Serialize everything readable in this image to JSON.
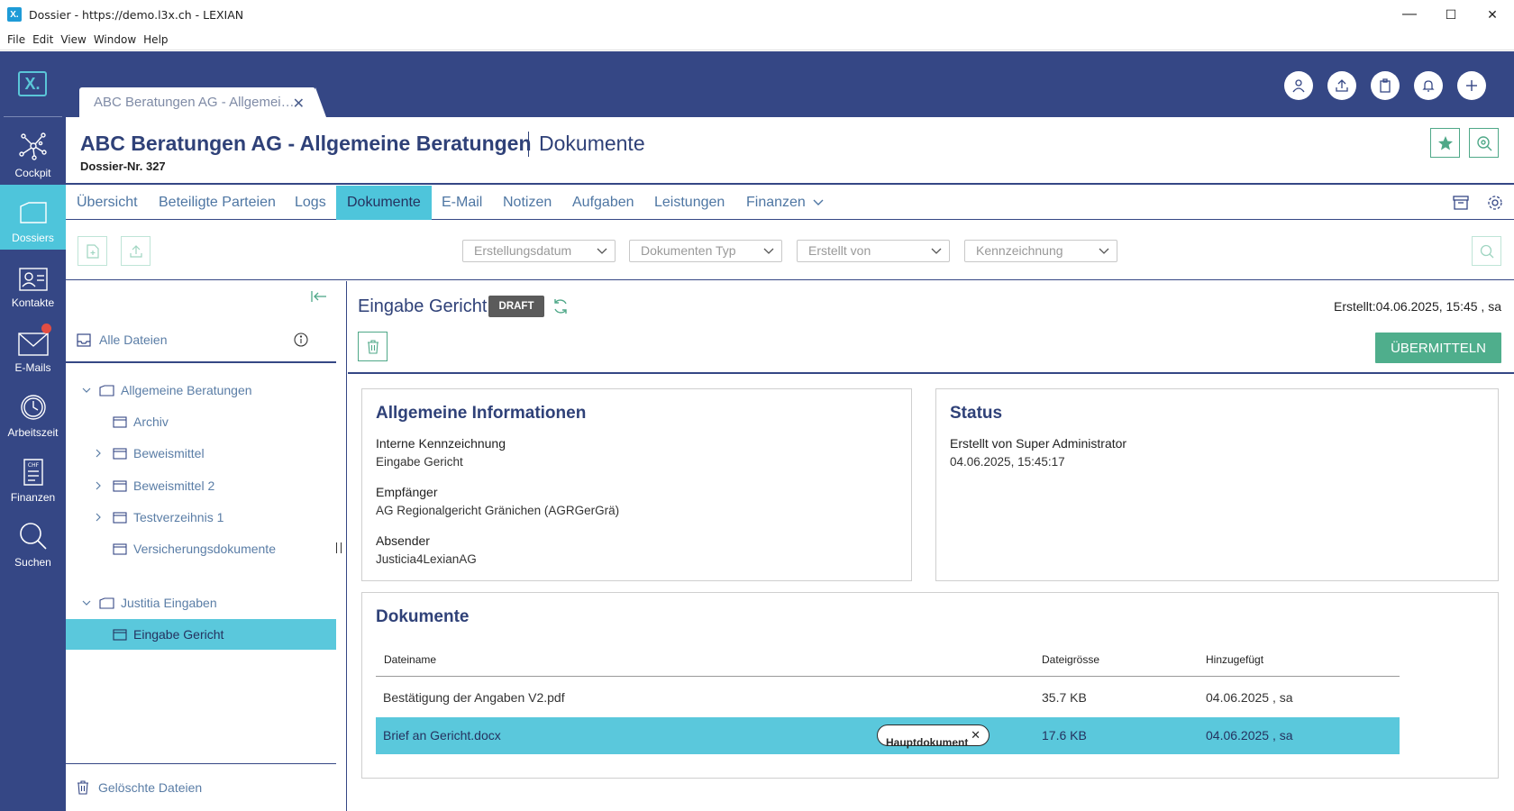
{
  "window": {
    "title": "Dossier - https://demo.l3x.ch - LEXIAN",
    "app_icon": "X.",
    "minimize": "—",
    "maximize": "☐",
    "close": "✕"
  },
  "menu": [
    "File",
    "Edit",
    "View",
    "Window",
    "Help"
  ],
  "nav": {
    "logo": "X.",
    "items": [
      {
        "label": "Cockpit",
        "icon": "network-icon"
      },
      {
        "label": "Dossiers",
        "icon": "folder-icon"
      },
      {
        "label": "Kontakte",
        "icon": "contact-card-icon"
      },
      {
        "label": "E-Mails",
        "icon": "envelope-icon"
      },
      {
        "label": "Arbeitszeit",
        "icon": "clock-icon"
      },
      {
        "label": "Finanzen",
        "icon": "invoice-icon"
      },
      {
        "label": "Suchen",
        "icon": "search-icon"
      }
    ]
  },
  "doc_tab": {
    "label": "ABC Beratungen AG - Allgemei…",
    "close": "✕"
  },
  "header": {
    "title": "ABC Beratungen AG - Allgemeine Beratungen",
    "subtitle": "Dokumente",
    "dossier_no": "Dossier-Nr. 327"
  },
  "tabs": [
    "Übersicht",
    "Beteiligte Parteien",
    "Logs",
    "Dokumente",
    "E-Mail",
    "Notizen",
    "Aufgaben",
    "Leistungen",
    "Finanzen"
  ],
  "filters": [
    {
      "placeholder": "Erstellungsdatum"
    },
    {
      "placeholder": "Dokumenten Typ"
    },
    {
      "placeholder": "Erstellt von"
    },
    {
      "placeholder": "Kennzeichnung"
    }
  ],
  "sidebar": {
    "all_files": "Alle Dateien",
    "tree": [
      {
        "label": "Allgemeine Beratungen",
        "level": 0,
        "expanded": true
      },
      {
        "label": "Archiv",
        "level": 1,
        "expandable": false
      },
      {
        "label": "Beweismittel",
        "level": 1,
        "expandable": true
      },
      {
        "label": "Beweismittel 2",
        "level": 1,
        "expandable": true
      },
      {
        "label": "Testverzeihnis 1",
        "level": 1,
        "expandable": true
      },
      {
        "label": "Versicherungsdokumente",
        "level": 1,
        "expandable": false
      },
      {
        "label": "Justitia Eingaben",
        "level": 0,
        "expanded": true
      },
      {
        "label": "Eingabe Gericht",
        "level": 1,
        "selected": true
      }
    ],
    "deleted": "Gelöschte Dateien"
  },
  "detail": {
    "title": "Eingabe Gericht",
    "badge": "DRAFT",
    "created": "Erstellt:04.06.2025, 15:45 ,  sa",
    "submit": "ÜBERMITTELN",
    "general": {
      "heading": "Allgemeine Informationen",
      "fields": [
        {
          "label": "Interne Kennzeichnung",
          "value": "Eingabe Gericht"
        },
        {
          "label": "Empfänger",
          "value": "AG Regionalgericht Gränichen (AGRGerGrä)"
        },
        {
          "label": "Absender",
          "value": "Justicia4LexianAG"
        }
      ]
    },
    "status": {
      "heading": "Status",
      "line1": "Erstellt von Super Administrator",
      "line2": "04.06.2025, 15:45:17"
    },
    "documents": {
      "heading": "Dokumente",
      "columns": [
        "Dateiname",
        "Dateigrösse",
        "Hinzugefügt"
      ],
      "rows": [
        {
          "name": "Bestätigung der Angaben V2.pdf",
          "size": "35.7 KB",
          "added": "04.06.2025 ,  sa",
          "tag": ""
        },
        {
          "name": "Brief an Gericht.docx",
          "size": "17.6 KB",
          "added": "04.06.2025 ,  sa",
          "tag": "Hauptdokument"
        }
      ]
    }
  },
  "colors": {
    "primary": "#354785",
    "accent": "#4ec5db",
    "success": "#4fae8c",
    "notification": "#e24d42"
  }
}
